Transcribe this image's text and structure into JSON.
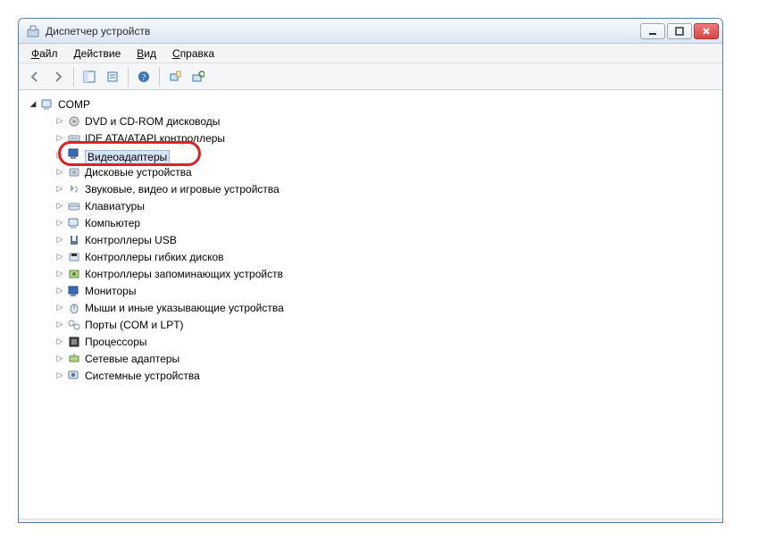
{
  "window": {
    "title": "Диспетчер устройств"
  },
  "menubar": {
    "file": "Файл",
    "action": "Действие",
    "view": "Вид",
    "help": "Справка"
  },
  "tree": {
    "root": "COMP",
    "items": [
      "DVD и CD-ROM дисководы",
      "IDE ATA/ATAPI контроллеры",
      "Видеоадаптеры",
      "Дисковые устройства",
      "Звуковые, видео и игровые устройства",
      "Клавиатуры",
      "Компьютер",
      "Контроллеры USB",
      "Контроллеры гибких дисков",
      "Контроллеры запоминающих устройств",
      "Мониторы",
      "Мыши и иные указывающие устройства",
      "Порты (COM и LPT)",
      "Процессоры",
      "Сетевые адаптеры",
      "Системные устройства"
    ]
  },
  "highlighted_index": 2
}
